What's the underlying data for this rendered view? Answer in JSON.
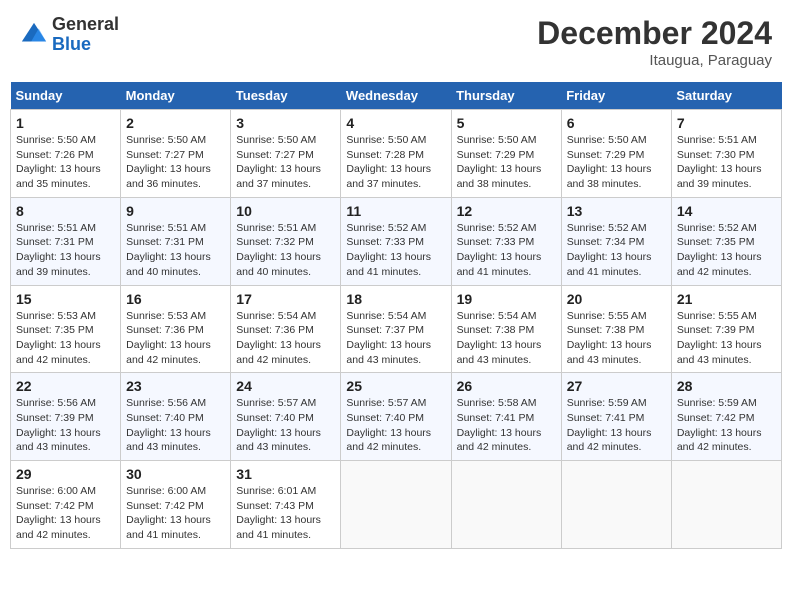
{
  "header": {
    "logo_line1": "General",
    "logo_line2": "Blue",
    "main_title": "December 2024",
    "subtitle": "Itaugua, Paraguay"
  },
  "calendar": {
    "days_of_week": [
      "Sunday",
      "Monday",
      "Tuesday",
      "Wednesday",
      "Thursday",
      "Friday",
      "Saturday"
    ],
    "weeks": [
      [
        {
          "num": "",
          "info": ""
        },
        {
          "num": "",
          "info": ""
        },
        {
          "num": "",
          "info": ""
        },
        {
          "num": "",
          "info": ""
        },
        {
          "num": "5",
          "info": "Sunrise: 5:50 AM\nSunset: 7:29 PM\nDaylight: 13 hours\nand 38 minutes."
        },
        {
          "num": "6",
          "info": "Sunrise: 5:50 AM\nSunset: 7:29 PM\nDaylight: 13 hours\nand 38 minutes."
        },
        {
          "num": "7",
          "info": "Sunrise: 5:51 AM\nSunset: 7:30 PM\nDaylight: 13 hours\nand 39 minutes."
        }
      ],
      [
        {
          "num": "1",
          "info": "Sunrise: 5:50 AM\nSunset: 7:26 PM\nDaylight: 13 hours\nand 35 minutes."
        },
        {
          "num": "2",
          "info": "Sunrise: 5:50 AM\nSunset: 7:27 PM\nDaylight: 13 hours\nand 36 minutes."
        },
        {
          "num": "3",
          "info": "Sunrise: 5:50 AM\nSunset: 7:27 PM\nDaylight: 13 hours\nand 37 minutes."
        },
        {
          "num": "4",
          "info": "Sunrise: 5:50 AM\nSunset: 7:28 PM\nDaylight: 13 hours\nand 37 minutes."
        },
        {
          "num": "5",
          "info": "Sunrise: 5:50 AM\nSunset: 7:29 PM\nDaylight: 13 hours\nand 38 minutes."
        },
        {
          "num": "6",
          "info": "Sunrise: 5:50 AM\nSunset: 7:29 PM\nDaylight: 13 hours\nand 38 minutes."
        },
        {
          "num": "7",
          "info": "Sunrise: 5:51 AM\nSunset: 7:30 PM\nDaylight: 13 hours\nand 39 minutes."
        }
      ],
      [
        {
          "num": "8",
          "info": "Sunrise: 5:51 AM\nSunset: 7:31 PM\nDaylight: 13 hours\nand 39 minutes."
        },
        {
          "num": "9",
          "info": "Sunrise: 5:51 AM\nSunset: 7:31 PM\nDaylight: 13 hours\nand 40 minutes."
        },
        {
          "num": "10",
          "info": "Sunrise: 5:51 AM\nSunset: 7:32 PM\nDaylight: 13 hours\nand 40 minutes."
        },
        {
          "num": "11",
          "info": "Sunrise: 5:52 AM\nSunset: 7:33 PM\nDaylight: 13 hours\nand 41 minutes."
        },
        {
          "num": "12",
          "info": "Sunrise: 5:52 AM\nSunset: 7:33 PM\nDaylight: 13 hours\nand 41 minutes."
        },
        {
          "num": "13",
          "info": "Sunrise: 5:52 AM\nSunset: 7:34 PM\nDaylight: 13 hours\nand 41 minutes."
        },
        {
          "num": "14",
          "info": "Sunrise: 5:52 AM\nSunset: 7:35 PM\nDaylight: 13 hours\nand 42 minutes."
        }
      ],
      [
        {
          "num": "15",
          "info": "Sunrise: 5:53 AM\nSunset: 7:35 PM\nDaylight: 13 hours\nand 42 minutes."
        },
        {
          "num": "16",
          "info": "Sunrise: 5:53 AM\nSunset: 7:36 PM\nDaylight: 13 hours\nand 42 minutes."
        },
        {
          "num": "17",
          "info": "Sunrise: 5:54 AM\nSunset: 7:36 PM\nDaylight: 13 hours\nand 42 minutes."
        },
        {
          "num": "18",
          "info": "Sunrise: 5:54 AM\nSunset: 7:37 PM\nDaylight: 13 hours\nand 43 minutes."
        },
        {
          "num": "19",
          "info": "Sunrise: 5:54 AM\nSunset: 7:38 PM\nDaylight: 13 hours\nand 43 minutes."
        },
        {
          "num": "20",
          "info": "Sunrise: 5:55 AM\nSunset: 7:38 PM\nDaylight: 13 hours\nand 43 minutes."
        },
        {
          "num": "21",
          "info": "Sunrise: 5:55 AM\nSunset: 7:39 PM\nDaylight: 13 hours\nand 43 minutes."
        }
      ],
      [
        {
          "num": "22",
          "info": "Sunrise: 5:56 AM\nSunset: 7:39 PM\nDaylight: 13 hours\nand 43 minutes."
        },
        {
          "num": "23",
          "info": "Sunrise: 5:56 AM\nSunset: 7:40 PM\nDaylight: 13 hours\nand 43 minutes."
        },
        {
          "num": "24",
          "info": "Sunrise: 5:57 AM\nSunset: 7:40 PM\nDaylight: 13 hours\nand 43 minutes."
        },
        {
          "num": "25",
          "info": "Sunrise: 5:57 AM\nSunset: 7:40 PM\nDaylight: 13 hours\nand 42 minutes."
        },
        {
          "num": "26",
          "info": "Sunrise: 5:58 AM\nSunset: 7:41 PM\nDaylight: 13 hours\nand 42 minutes."
        },
        {
          "num": "27",
          "info": "Sunrise: 5:59 AM\nSunset: 7:41 PM\nDaylight: 13 hours\nand 42 minutes."
        },
        {
          "num": "28",
          "info": "Sunrise: 5:59 AM\nSunset: 7:42 PM\nDaylight: 13 hours\nand 42 minutes."
        }
      ],
      [
        {
          "num": "29",
          "info": "Sunrise: 6:00 AM\nSunset: 7:42 PM\nDaylight: 13 hours\nand 42 minutes."
        },
        {
          "num": "30",
          "info": "Sunrise: 6:00 AM\nSunset: 7:42 PM\nDaylight: 13 hours\nand 41 minutes."
        },
        {
          "num": "31",
          "info": "Sunrise: 6:01 AM\nSunset: 7:43 PM\nDaylight: 13 hours\nand 41 minutes."
        },
        {
          "num": "",
          "info": ""
        },
        {
          "num": "",
          "info": ""
        },
        {
          "num": "",
          "info": ""
        },
        {
          "num": "",
          "info": ""
        }
      ]
    ]
  }
}
